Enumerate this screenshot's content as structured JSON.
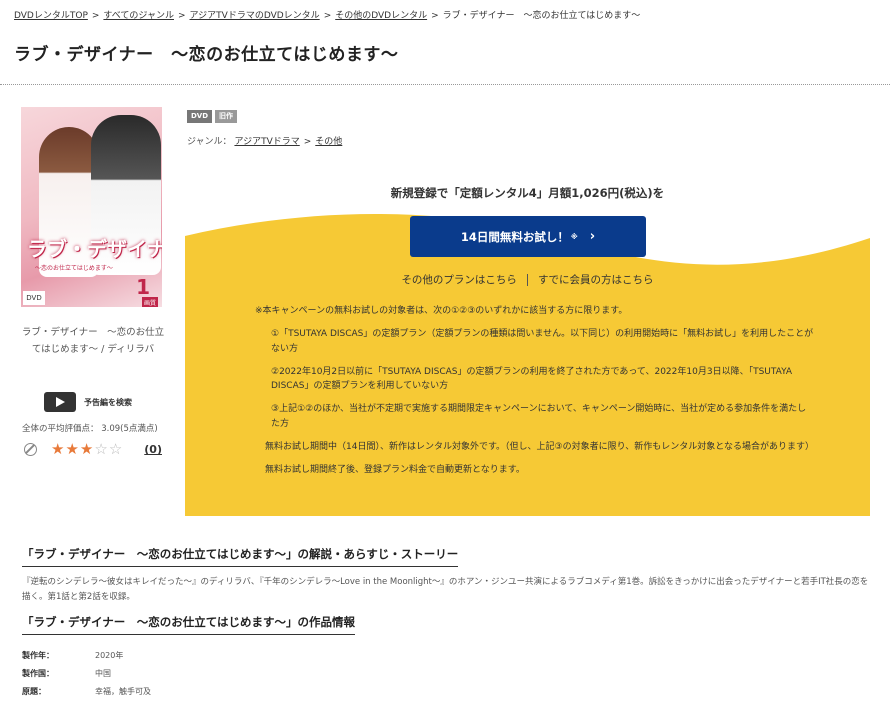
{
  "breadcrumb": {
    "items": [
      "DVDレンタルTOP",
      "すべてのジャンル",
      "アジアTVドラマのDVDレンタル",
      "その他のDVDレンタル"
    ],
    "current": "ラブ・デザイナー　～恋のお仕立てはじめます～",
    "sep": ">"
  },
  "title": "ラブ・デザイナー　～恋のお仕立てはじめます～",
  "cover": {
    "logo_text": "ラブ・デザイナー",
    "sub_text": "～恋のお仕立てはじめます～",
    "vol": "1",
    "badge": "DVD",
    "hint": "画質"
  },
  "cover_caption": "ラブ・デザイナー　～恋のお仕立てはじめます～ / ディリラバ",
  "trailer_label": "予告編を検索",
  "avg_rating_text": "全体の平均評価点： 3.09(5点満点)",
  "rating": {
    "value": 3,
    "max": 5,
    "review_count": "(0)"
  },
  "tags": [
    "DVD",
    "旧作"
  ],
  "genre": {
    "label": "ジャンル：",
    "items": [
      "アジアTVドラマ",
      "その他"
    ],
    "sep": ">"
  },
  "promo": {
    "headline": "新規登録で「定額レンタル4」月額1,026円(税込)を",
    "cta_label": "14日間無料お試し！",
    "cta_note": "※",
    "cta_chevron": "›",
    "link_other_plans": "その他のプランはこちら",
    "link_member": "すでに会員の方はこちら",
    "accent_color": "#f6c935",
    "cta_color": "#0a3b8c"
  },
  "terms": {
    "lead": "※本キャンペーンの無料お試しの対象者は、次の①②③のいずれかに該当する方に限ります。",
    "items": [
      "①「TSUTAYA DISCAS」の定額プラン（定額プランの種類は問いません。以下同じ）の利用開始時に「無料お試し」を利用したことがない方",
      "②2022年10月2日以前に「TSUTAYA DISCAS」の定額プランの利用を終了された方であって、2022年10月3日以降、「TSUTAYA DISCAS」の定額プランを利用していない方",
      "③上記①②のほか、当社が不定期で実施する期間限定キャンペーンにおいて、キャンペーン開始時に、当社が定める参加条件を満たした方"
    ],
    "notes": [
      "無料お試し期間中（14日間）、新作はレンタル対象外です。（但し、上記③の対象者に限り、新作もレンタル対象となる場合があります）",
      "無料お試し期間終了後、登録プラン料金で自動更新となります。"
    ]
  },
  "story": {
    "heading": "「ラブ・デザイナー　～恋のお仕立てはじめます～」の解説・あらすじ・ストーリー",
    "text": "『逆転のシンデレラ～彼女はキレイだった～』のディリラバ、『千年のシンデレラ～Love in the Moonlight～』のホアン・ジンユー共演によるラブコメディ第1巻。訴訟をきっかけに出会ったデザイナーと若手IT社長の恋を描く。第1話と第2話を収録。"
  },
  "work_info": {
    "heading": "「ラブ・デザイナー　～恋のお仕立てはじめます～」の作品情報",
    "rows": [
      {
        "key": "製作年：",
        "value": "2020年"
      },
      {
        "key": "製作国：",
        "value": "中国"
      },
      {
        "key": "原題：",
        "value": "幸福，触手可及"
      }
    ]
  }
}
